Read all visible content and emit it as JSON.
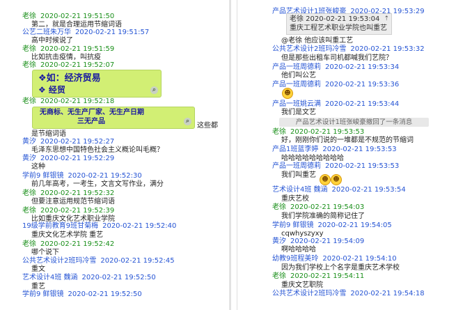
{
  "left": {
    "entries": [
      {
        "name": "老徐",
        "time": "2020-02-21 19:51:50",
        "msg": "第二，就是合理运用节缩词语",
        "c": "g"
      },
      {
        "name": "公艺二班朱万华",
        "time": "2020-02-21 19:51:57",
        "msg": "高中时候说了",
        "c": "b"
      },
      {
        "name": "老徐",
        "time": "2020-02-21 19:51:59",
        "msg": "比如抗击疫情，叫抗疫",
        "c": "g"
      },
      {
        "name": "老徐",
        "time": "2020-02-21 19:52:07",
        "msg": "",
        "c": "g"
      },
      {
        "name": "老徐",
        "time": "2020-02-21 19:52:18",
        "msg": "",
        "c": "g"
      },
      {
        "name": "",
        "time": "",
        "msg": "是节缩词语",
        "c": "g"
      },
      {
        "name": "黄汐",
        "time": "2020-02-21 19:52:27",
        "msg": "毛泽东思想中国特色社会主义概论叫毛概？",
        "c": "b"
      },
      {
        "name": "黄汐",
        "time": "2020-02-21 19:52:29",
        "msg": "这种",
        "c": "b"
      },
      {
        "name": "学前9   鲜银镜",
        "time": "2020-02-21 19:52:30",
        "msg": "前几年高考，一考生，文言文写作业，满分",
        "c": "b"
      },
      {
        "name": "老徐",
        "time": "2020-02-21 19:52:32",
        "msg": "但要注意运用规范节缩词语",
        "c": "g"
      },
      {
        "name": "老徐",
        "time": "2020-02-21 19:52:39",
        "msg": "比如重庆文化艺术职业学院",
        "c": "g"
      },
      {
        "name": "19级学前教育9班甘菊梅",
        "time": "2020-02-21 19:52:40",
        "msg": "重庆文化艺术学院 重艺",
        "c": "b"
      },
      {
        "name": "老徐",
        "time": "2020-02-21 19:52:42",
        "msg": "哪个说下",
        "c": "g"
      },
      {
        "name": "公共艺术设计2班玛冷雪",
        "time": "2020-02-21 19:52:45",
        "msg": "重文",
        "c": "b"
      },
      {
        "name": "艺术设计4班        魏涵",
        "time": "2020-02-21 19:52:50",
        "msg": "重艺",
        "c": "b"
      },
      {
        "name": "学前9   鲜银镜",
        "time": "2020-02-21 19:52:50",
        "msg": "",
        "c": "b"
      }
    ],
    "bubble1": {
      "line1": "❖如：经济贸易",
      "line2": "❖     经贸"
    },
    "bubble2": {
      "line1": "无商标、无生产厂家、无生产日期",
      "line2": "三无产品",
      "line3": "~ 沿 ~ 。"
    },
    "bubble2_trail": "这些都"
  },
  "right": {
    "entries": [
      {
        "name": "产品艺术设计1班张峻豪",
        "time": "2020-02-21 19:53:29",
        "msg": "",
        "c": "b"
      },
      {
        "name": "",
        "time": "",
        "msg": "@老徐 他应该叫重工艺",
        "c": "b"
      },
      {
        "name": "公共艺术设计2班玛冷雪",
        "time": "2020-02-21 19:53:32",
        "msg": "但是那些出租车司机都喊我们艺院？",
        "c": "b"
      },
      {
        "name": "产品一班周德莉",
        "time": "2020-02-21 19:53:34",
        "msg": "他们叫公艺",
        "c": "b"
      },
      {
        "name": "产品一班周德莉",
        "time": "2020-02-21 19:53:36",
        "msg": "",
        "c": "b"
      },
      {
        "name": "产品一班姚云满",
        "time": "2020-02-21 19:53:44",
        "msg": "我们是文艺",
        "c": "b"
      },
      {
        "name": "老徐",
        "time": "2020-02-21 19:53:53",
        "msg": "好，刚刚你们说的一堆都是不规范的节缩词",
        "c": "g"
      },
      {
        "name": "产品1班蓝李婷",
        "time": "2020-02-21 19:53:53",
        "msg": "哈哈哈哈哈哈哈哈哈",
        "c": "b"
      },
      {
        "name": "产品一班周德莉",
        "time": "2020-02-21 19:53:53",
        "msg": "我们叫重艺",
        "c": "b"
      },
      {
        "name": "艺术设计4班        魏涵",
        "time": "2020-02-21 19:53:54",
        "msg": "重庆艺校",
        "c": "b"
      },
      {
        "name": "老徐",
        "time": "2020-02-21 19:54:03",
        "msg": "我们学院准确的简称记住了",
        "c": "g"
      },
      {
        "name": "学前9   鲜银镜",
        "time": "2020-02-21 19:54:05",
        "msg": "cqwhyszyxy",
        "c": "b"
      },
      {
        "name": "黄汐",
        "time": "2020-02-21 19:54:09",
        "msg": "啊哈哈哈哈",
        "c": "b"
      },
      {
        "name": "幼教9班程美玲",
        "time": "2020-02-21 19:54:10",
        "msg": "因为我们学校上个名字是重庆艺术学校",
        "c": "b"
      },
      {
        "name": "老徐",
        "time": "2020-02-21 19:54:11",
        "msg": "重庆文艺职院",
        "c": "g"
      },
      {
        "name": "公共艺术设计2班玛冷雪",
        "time": "2020-02-21 19:54:18",
        "msg": "",
        "c": "b"
      }
    ],
    "quote": {
      "line1": "老徐  2020-02-21 19:53:04",
      "line2": "重庆工程艺术职业学院也叫重艺"
    },
    "system_notice": "产品艺术设计1班张峻豪撤回了一条消息",
    "emoji_icon": "smiley-emoji-icon"
  }
}
